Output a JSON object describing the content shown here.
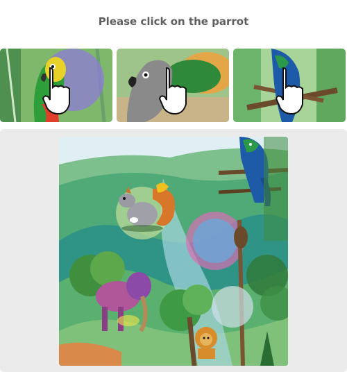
{
  "prompt": {
    "text": "Please click on the parrot"
  },
  "examples": [
    {
      "subject": "parrot",
      "style": "watercolor"
    },
    {
      "subject": "parrot",
      "style": "watercolor"
    },
    {
      "subject": "parrot",
      "style": "watercolor"
    }
  ],
  "scene": {
    "icons": [
      "squirrel-icon",
      "parrot-icon",
      "elephant-icon",
      "lion-icon",
      "monkey-icon",
      "hand-pointer-icon"
    ]
  }
}
